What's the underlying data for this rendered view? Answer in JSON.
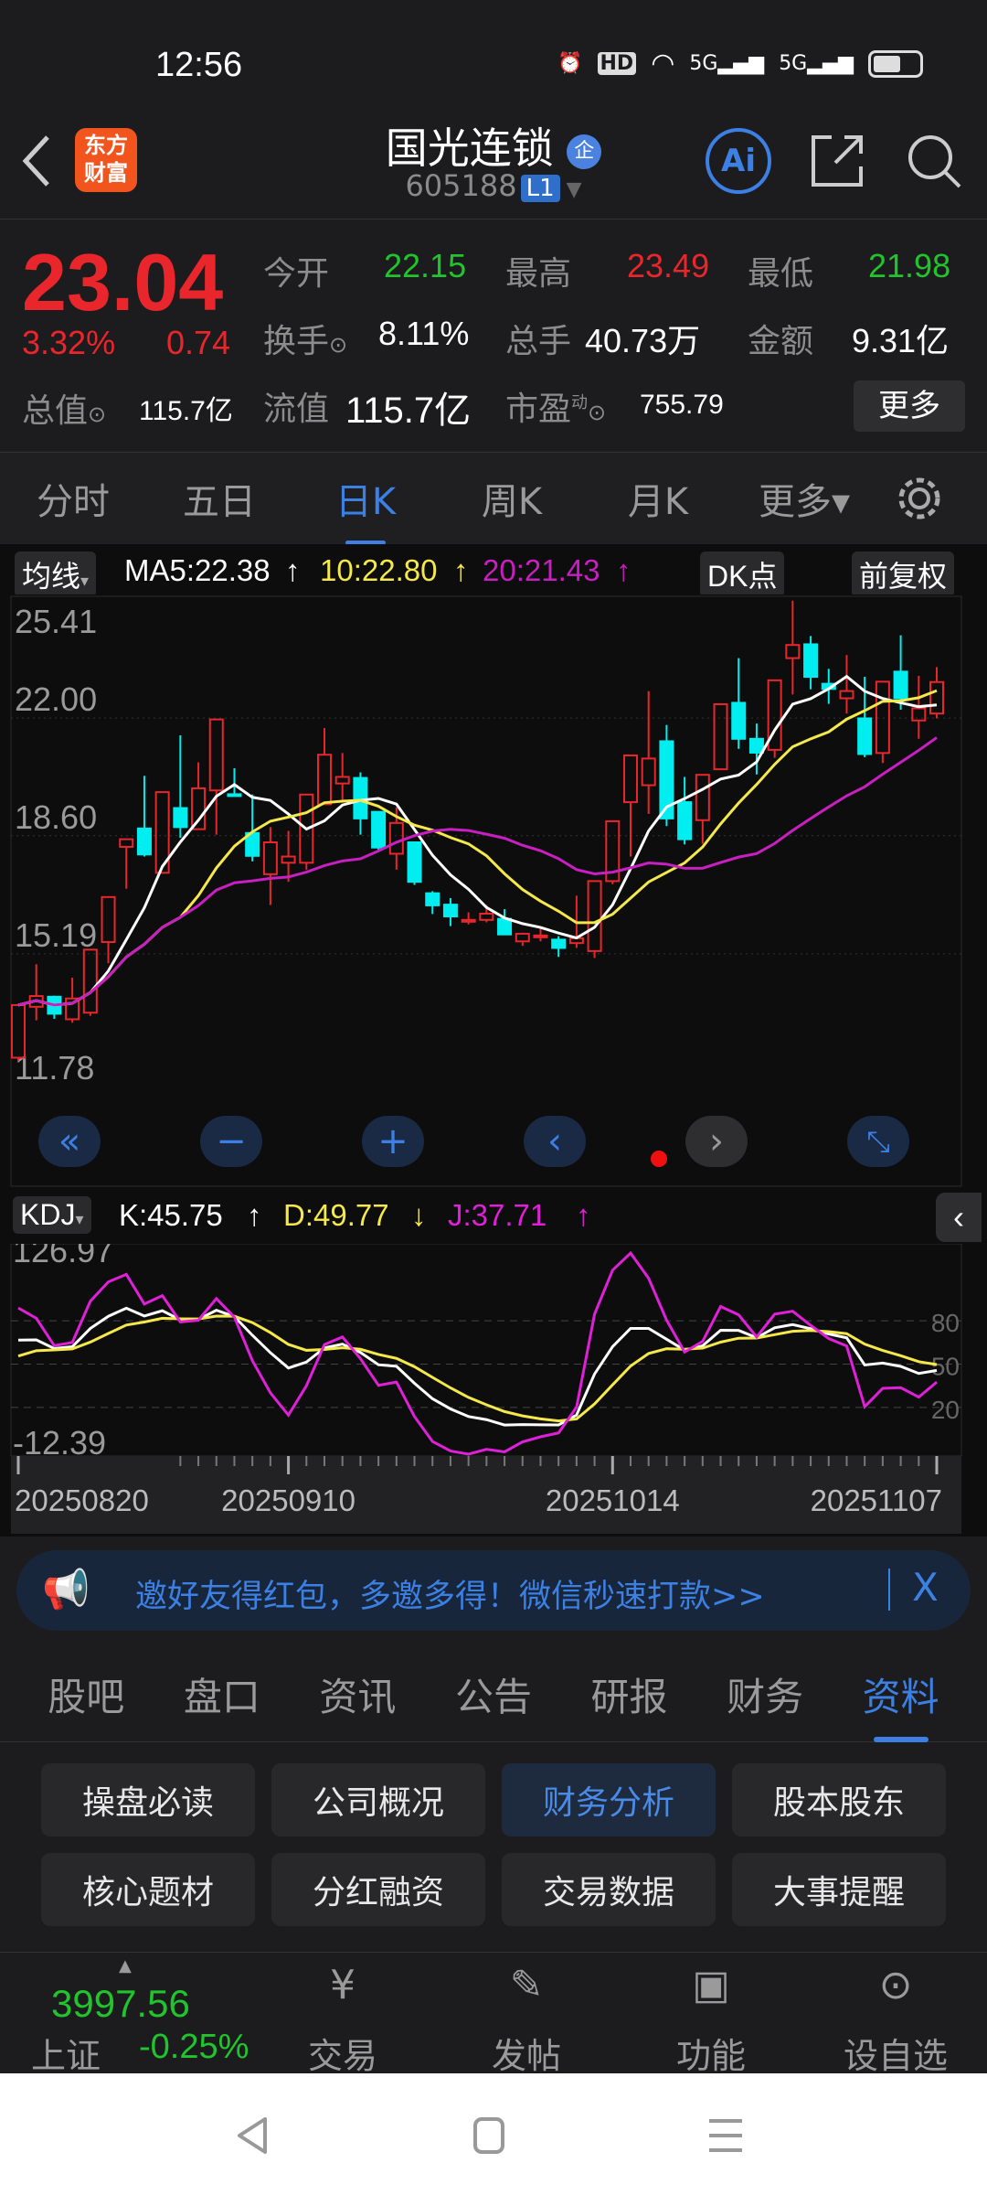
{
  "status_bar": {
    "time": "12:56",
    "icons": [
      "alarm-icon",
      "hd-icon",
      "wifi-icon",
      "signal-5g-icon",
      "signal-5g-icon",
      "battery-icon"
    ],
    "hd": "HD",
    "net1": "5G",
    "net2": "5G"
  },
  "header": {
    "logo_line1": "东方",
    "logo_line2": "财富",
    "title": "国光连锁",
    "badge": "企",
    "code": "605188",
    "level": "L1",
    "ai_label": "Ai"
  },
  "quote": {
    "price": "23.04",
    "change_pct": "3.32%",
    "change": "0.74",
    "open_label": "今开",
    "open": "22.15",
    "high_label": "最高",
    "high": "23.49",
    "low_label": "最低",
    "low": "21.98",
    "turnover_label": "换手",
    "turnover": "8.11%",
    "volume_label": "总手",
    "volume": "40.73万",
    "amount_label": "金额",
    "amount": "9.31亿",
    "mktcap_label": "总值",
    "mktcap": "115.7亿",
    "float_label": "流值",
    "float": "115.7亿",
    "pe_label": "市盈",
    "pe_sup": "动",
    "pe": "755.79",
    "more": "更多"
  },
  "period_tabs": [
    {
      "label": "分时"
    },
    {
      "label": "五日"
    },
    {
      "label": "日K",
      "active": true
    },
    {
      "label": "周K"
    },
    {
      "label": "月K"
    },
    {
      "label": "更多▾"
    }
  ],
  "ma_row": {
    "selector": "均线",
    "ma5": "MA5:22.38",
    "ma10": "10:22.80",
    "ma20": "20:21.43",
    "dk": "DK点",
    "adjust": "前复权"
  },
  "kdj_row": {
    "selector": "KDJ",
    "k": "K:45.75",
    "d": "D:49.77",
    "j": "J:37.71"
  },
  "colors": {
    "up": "#e8262b",
    "down": "#00eef0",
    "ma5": "#ffffff",
    "ma10": "#f5e84a",
    "ma20": "#c81fc0",
    "accent": "#3d80e4",
    "k": "#ffffff",
    "d": "#f5e84a",
    "j": "#e020d8"
  },
  "chart_data": [
    {
      "type": "candlestick",
      "title": "",
      "y_ticks": [
        "25.41",
        "22.00",
        "18.60",
        "15.19",
        "11.78"
      ],
      "ylim": [
        11.78,
        25.41
      ],
      "grid": true,
      "fields": [
        "open",
        "high",
        "low",
        "close"
      ],
      "x_ticks": [
        {
          "index": 0,
          "label": "20250820"
        },
        {
          "index": 15,
          "label": "20250910"
        },
        {
          "index": 33,
          "label": "20251014"
        },
        {
          "index": 51,
          "label": "20251107"
        }
      ],
      "candles": [
        [
          12.19,
          13.71,
          12.1,
          13.71
        ],
        [
          13.66,
          14.89,
          13.27,
          13.97
        ],
        [
          13.95,
          13.98,
          13.31,
          13.46
        ],
        [
          13.3,
          14.5,
          13.2,
          13.9
        ],
        [
          13.49,
          15.31,
          13.4,
          15.31
        ],
        [
          15.53,
          16.83,
          14.92,
          16.83
        ],
        [
          18.28,
          18.5,
          17.07,
          18.5
        ],
        [
          18.81,
          20.33,
          18.0,
          18.06
        ],
        [
          17.53,
          19.86,
          17.5,
          19.86
        ],
        [
          19.4,
          21.5,
          18.54,
          18.85
        ],
        [
          18.79,
          20.72,
          18.79,
          19.97
        ],
        [
          19.91,
          21.96,
          18.63,
          21.96
        ],
        [
          19.8,
          20.55,
          19.75,
          19.75
        ],
        [
          18.68,
          19.79,
          17.86,
          18.02
        ],
        [
          17.49,
          18.85,
          16.6,
          18.41
        ],
        [
          17.82,
          18.74,
          17.27,
          18.0
        ],
        [
          17.82,
          19.79,
          17.62,
          19.79
        ],
        [
          19.51,
          21.71,
          19.51,
          20.94
        ],
        [
          20.11,
          20.99,
          19.6,
          20.3
        ],
        [
          20.27,
          20.43,
          18.63,
          19.1
        ],
        [
          19.29,
          19.3,
          18.2,
          18.26
        ],
        [
          18.08,
          19.42,
          17.62,
          18.97
        ],
        [
          18.41,
          18.41,
          17.18,
          17.27
        ],
        [
          16.94,
          17.0,
          16.34,
          16.59
        ],
        [
          16.61,
          16.8,
          15.99,
          16.27
        ],
        [
          16.15,
          16.39,
          16.04,
          16.17
        ],
        [
          16.17,
          16.6,
          16.1,
          16.35
        ],
        [
          16.2,
          16.48,
          15.73,
          15.75
        ],
        [
          15.55,
          15.8,
          15.42,
          15.77
        ],
        [
          15.7,
          15.95,
          15.55,
          15.72
        ],
        [
          15.6,
          15.7,
          15.1,
          15.36
        ],
        [
          15.5,
          16.87,
          15.36,
          15.64
        ],
        [
          15.27,
          17.29,
          15.07,
          17.29
        ],
        [
          17.29,
          19.02,
          17.2,
          19.02
        ],
        [
          19.57,
          20.92,
          18.0,
          20.92
        ],
        [
          20.06,
          22.78,
          19.23,
          20.83
        ],
        [
          21.33,
          21.8,
          18.88,
          19.1
        ],
        [
          19.57,
          20.3,
          18.35,
          18.5
        ],
        [
          19.05,
          20.36,
          18.37,
          20.36
        ],
        [
          20.52,
          22.4,
          20.5,
          22.4
        ],
        [
          22.44,
          23.73,
          21.11,
          21.4
        ],
        [
          21.4,
          21.84,
          20.37,
          21.0
        ],
        [
          21.08,
          23.09,
          20.85,
          23.09
        ],
        [
          23.73,
          25.39,
          22.68,
          24.11
        ],
        [
          24.13,
          24.37,
          22.83,
          23.19
        ],
        [
          22.99,
          23.42,
          22.41,
          22.84
        ],
        [
          22.57,
          23.82,
          22.13,
          22.78
        ],
        [
          21.99,
          23.19,
          20.87,
          20.96
        ],
        [
          20.99,
          23.05,
          20.7,
          23.05
        ],
        [
          23.34,
          24.39,
          22.24,
          22.57
        ],
        [
          21.93,
          23.22,
          21.4,
          22.28
        ],
        [
          22.13,
          23.47,
          21.99,
          23.04
        ]
      ],
      "series": [
        {
          "name": "MA5",
          "period": 5
        },
        {
          "name": "MA10",
          "period": 10
        },
        {
          "name": "MA20",
          "period": 20
        }
      ]
    },
    {
      "type": "line",
      "title": "",
      "y_ticks": [
        "126.97",
        "-12.39"
      ],
      "ref_lines": [
        "80",
        "50",
        "20"
      ],
      "ylim": [
        -12.39,
        126.97
      ],
      "series": [
        {
          "name": "K"
        },
        {
          "name": "D"
        },
        {
          "name": "J"
        }
      ]
    }
  ],
  "banner": {
    "text": "邀好友得红包，多邀多得！微信秒速打款>>",
    "close": "X"
  },
  "info_tabs": [
    {
      "label": "股吧"
    },
    {
      "label": "盘口"
    },
    {
      "label": "资讯"
    },
    {
      "label": "公告"
    },
    {
      "label": "研报"
    },
    {
      "label": "财务"
    },
    {
      "label": "资料",
      "active": true
    }
  ],
  "info_buttons": [
    {
      "label": "操盘必读"
    },
    {
      "label": "公司概况"
    },
    {
      "label": "财务分析",
      "active": true
    },
    {
      "label": "股本股东"
    },
    {
      "label": "核心题材"
    },
    {
      "label": "分红融资"
    },
    {
      "label": "交易数据"
    },
    {
      "label": "大事提醒"
    }
  ],
  "bottom_bar": {
    "index_value": "3997.56",
    "index_name": "上证",
    "index_change": "-0.25%",
    "items": [
      {
        "label": "交易"
      },
      {
        "label": "发帖"
      },
      {
        "label": "功能"
      },
      {
        "label": "设自选"
      }
    ]
  }
}
